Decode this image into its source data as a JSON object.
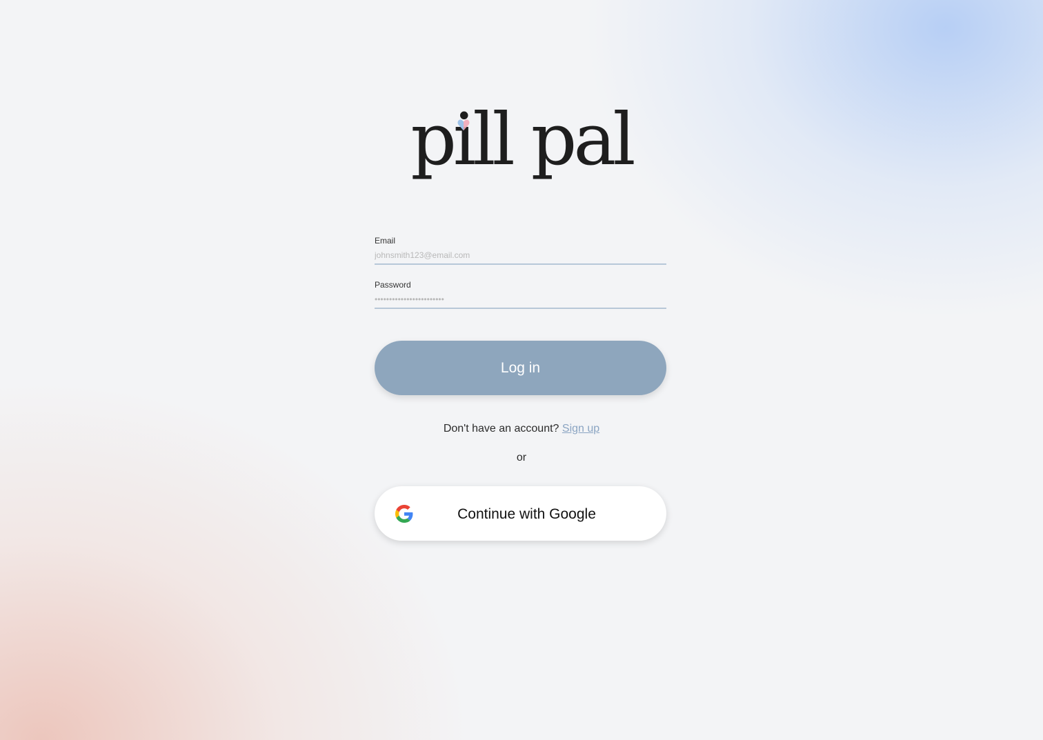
{
  "brand": {
    "logo_text": "pill pal",
    "logo_icon": "heart-icon",
    "heart_colors": [
      "#f2a9b8",
      "#9ec3ea"
    ]
  },
  "form": {
    "email": {
      "label": "Email",
      "placeholder": "johnsmith123@email.com"
    },
    "password": {
      "label": "Password",
      "placeholder": "••••••••••••••••••••••••"
    }
  },
  "actions": {
    "login_label": "Log in",
    "signup_prompt": "Don't have an account?",
    "signup_link": "Sign up",
    "divider_text": "or",
    "google_label": "Continue with Google",
    "google_icon": "google-icon"
  },
  "colors": {
    "login_button": "#8ea6bd",
    "link": "#8aa4c2",
    "input_underline": "#b7c7d8"
  }
}
